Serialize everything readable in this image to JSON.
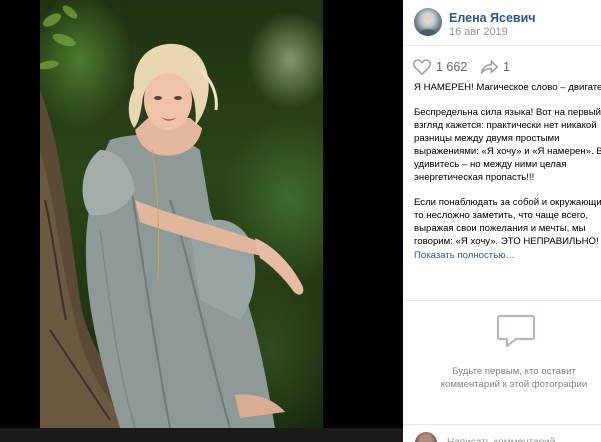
{
  "author": {
    "name": "Елена Ясевич",
    "date": "16 авг 2019"
  },
  "actions": {
    "likes": "1 662",
    "shares": "1",
    "like_icon": "heart-icon",
    "share_icon": "share-arrow-icon"
  },
  "caption": {
    "line1": "Я НАМЕРЕН! Магическое слово – двигател",
    "line2": "Беспредельна сила языка! Вот на первый",
    "line3": "взгляд кажется: практически нет никакой",
    "line4": "разницы между двумя простыми",
    "line5": "выражениями: «Я хочу» и «Я намерен». Вы",
    "line6": "удивитесь – но между ними целая",
    "line7": "энергетическая пропасть!!!",
    "line8": "Если понаблюдать за собой и окружающим",
    "line9": "то несложно заметить, что чаще всего,",
    "line10": "выражая свои пожелания и мечты, мы",
    "line11": "говорим: «Я хочу». ЭТО НЕПРАВИЛЬНО!",
    "show_more": "Показать полностью…"
  },
  "comments": {
    "empty_text": "Будьте первым, кто оставит\nкомментарий к этой фотографии",
    "icon": "comment-bubble-icon"
  },
  "composer": {
    "placeholder": "Написать комментарий…"
  },
  "colors": {
    "link": "#2a5885",
    "muted": "#939393",
    "divider": "#e7e8ec"
  }
}
